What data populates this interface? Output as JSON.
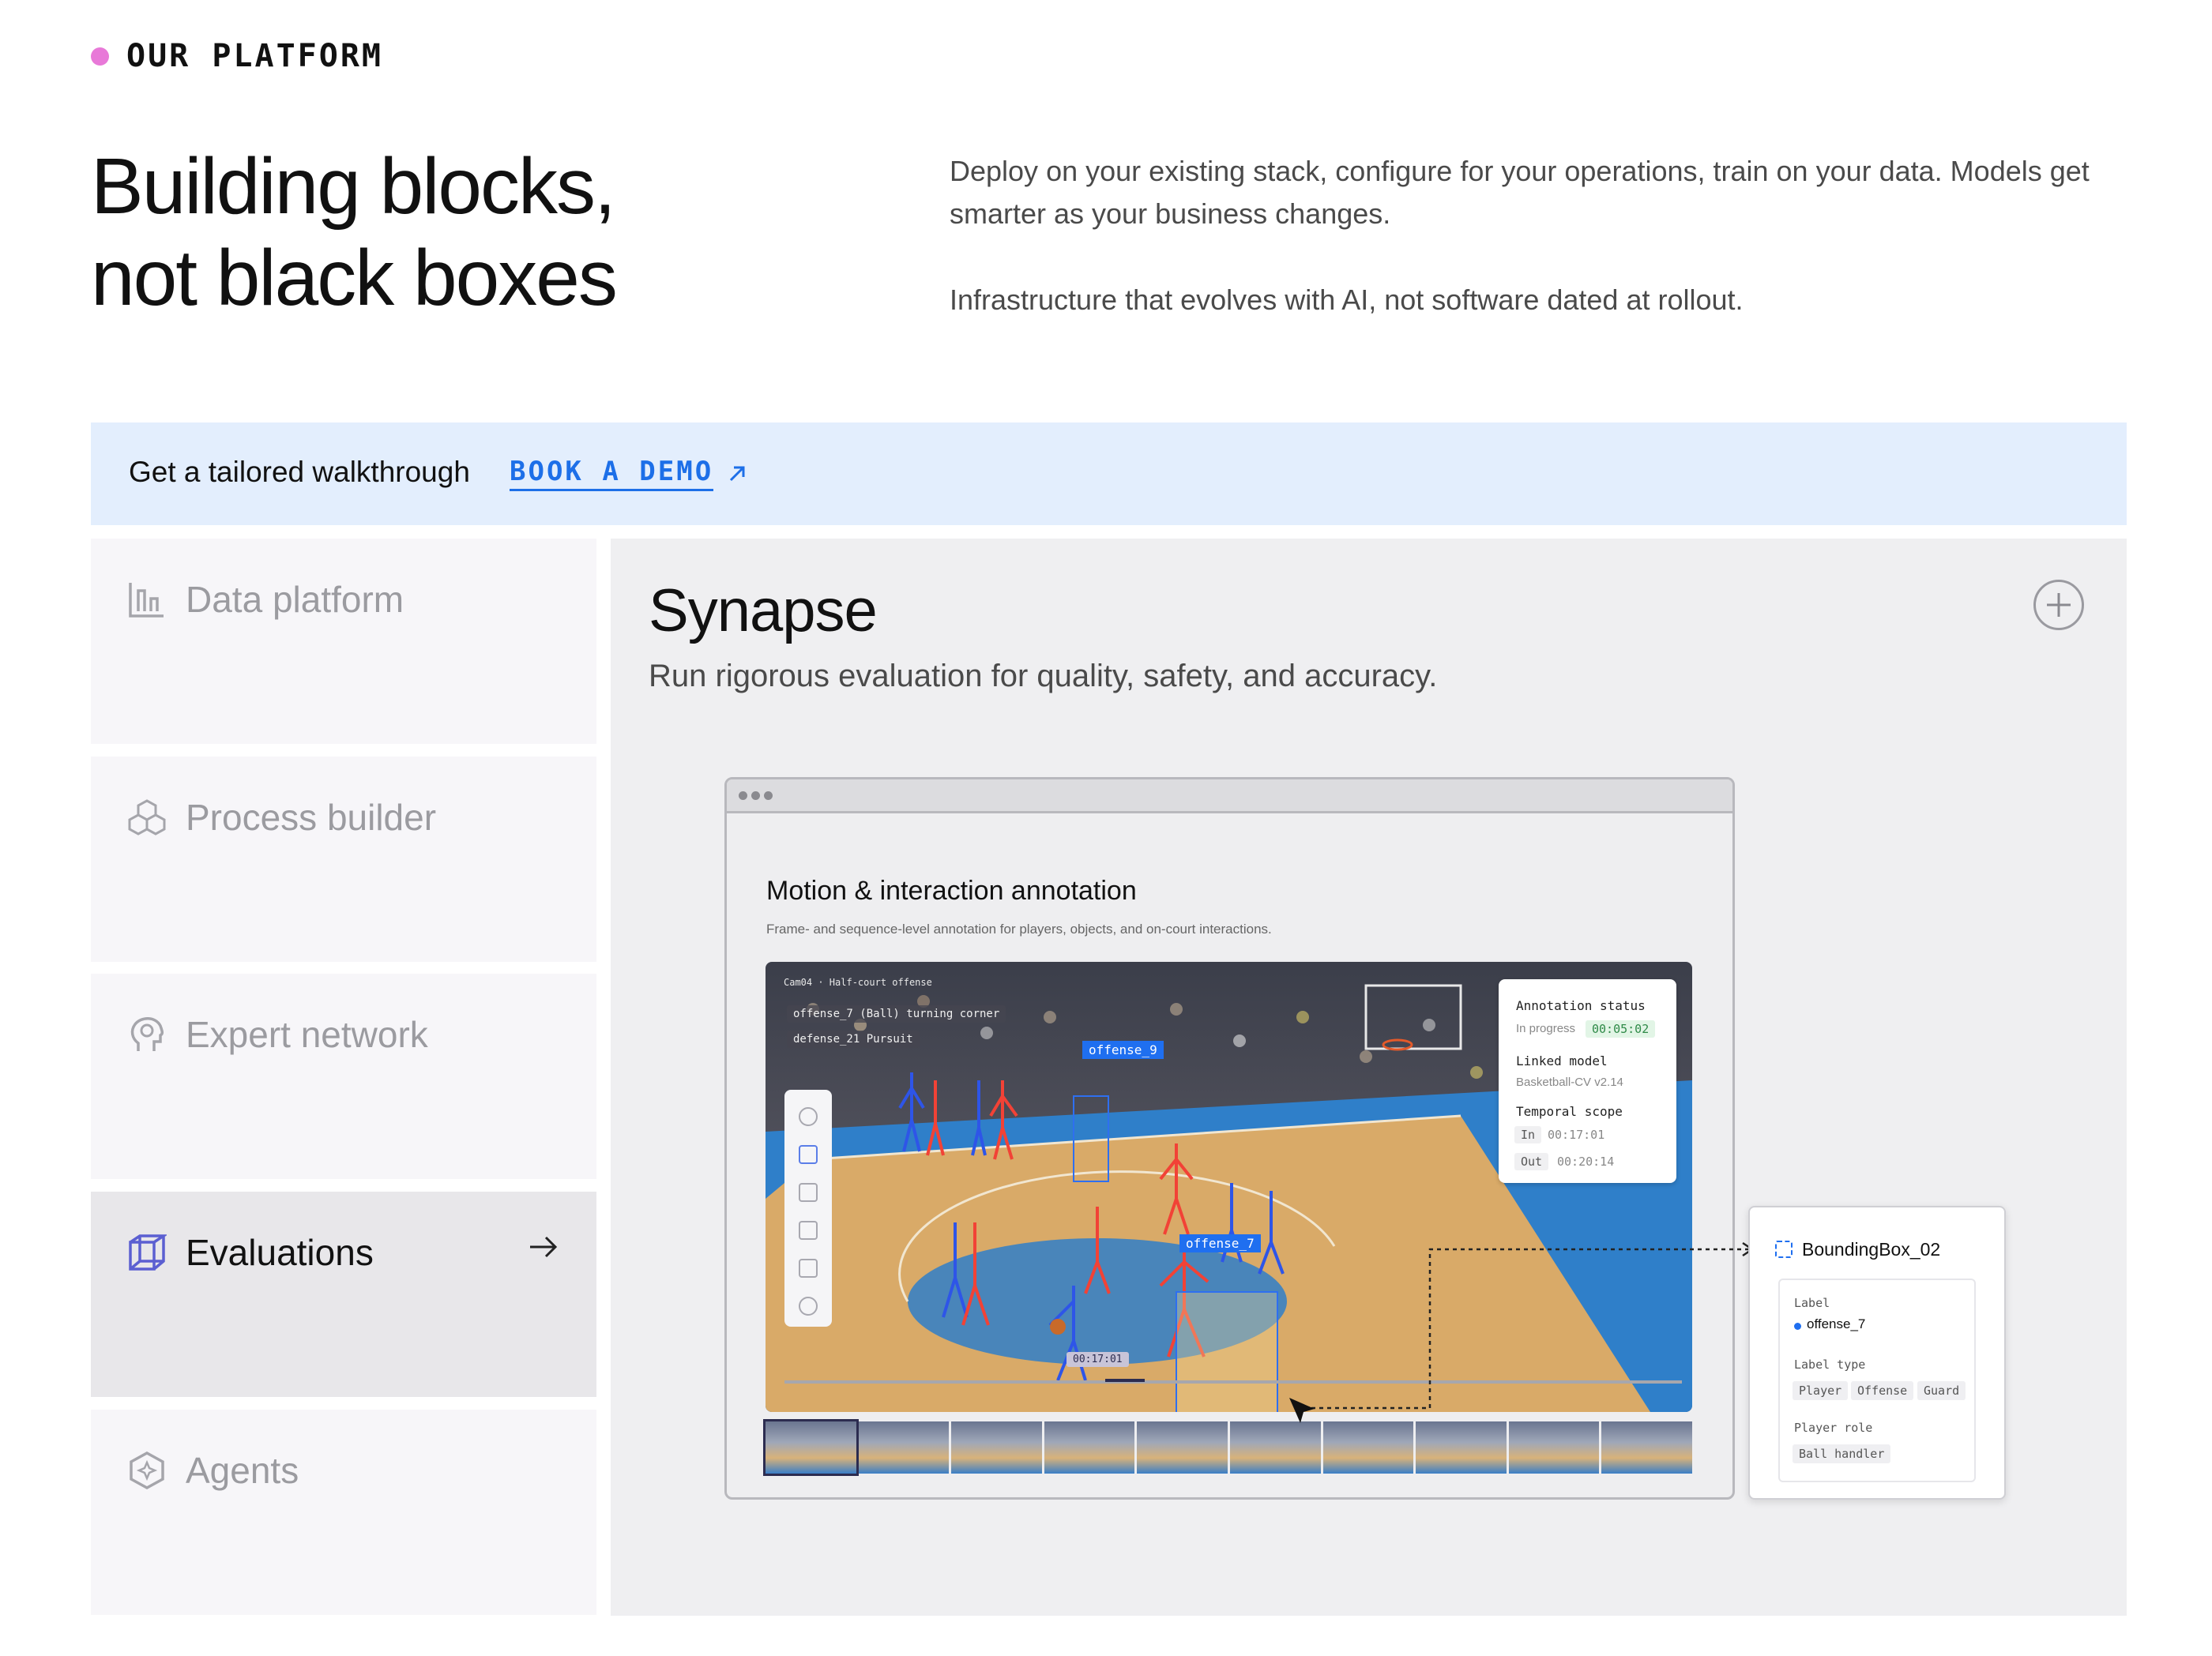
{
  "eyebrow": "OUR PLATFORM",
  "hero": {
    "title_line1": "Building blocks,",
    "title_line2": "not black boxes",
    "paragraph1": "Deploy on your existing stack, configure for your operations, train on your data. Models get smarter as your business changes.",
    "paragraph2": "Infrastructure that evolves with AI, not software dated at rollout."
  },
  "banner": {
    "label": "Get a tailored walkthrough",
    "cta": "BOOK A DEMO",
    "cta_icon": "arrow-up-right-icon",
    "background": "#e3eefd",
    "cta_color": "#1d6fe8"
  },
  "sidebar": {
    "items": [
      {
        "label": "Data platform",
        "icon": "chart-icon",
        "active": false
      },
      {
        "label": "Process builder",
        "icon": "blocks-icon",
        "active": false
      },
      {
        "label": "Expert network",
        "icon": "head-icon",
        "active": false
      },
      {
        "label": "Evaluations",
        "icon": "cube-icon",
        "active": true
      },
      {
        "label": "Agents",
        "icon": "hexagon-sparkle-icon",
        "active": false
      }
    ]
  },
  "panel": {
    "title": "Synapse",
    "subtitle": "Run rigorous evaluation for quality, safety, and accuracy.",
    "expand_icon": "plus-circle-icon"
  },
  "window": {
    "title": "Motion & interaction annotation",
    "subtitle": "Frame- and sequence-level annotation for players, objects, and on-court interactions.",
    "scene_tags": {
      "camera": "Cam04 · Half-court offense",
      "tag1": "offense_7 (Ball) turning corner",
      "tag2": "defense_21 Pursuit"
    },
    "bbox_labels": [
      "offense_9",
      "offense_7"
    ],
    "timecode": "00:17:01"
  },
  "status": {
    "annotation_status_label": "Annotation status",
    "annotation_status_value": "In progress",
    "annotation_time": "00:05:02",
    "linked_model_label": "Linked model",
    "linked_model_value": "Basketball-CV v2.14",
    "temporal_scope_label": "Temporal scope",
    "in_label": "In",
    "in_time": "00:17:01",
    "out_label": "Out",
    "out_time": "00:20:14"
  },
  "bbcard": {
    "title": "BoundingBox_02",
    "label_key": "Label",
    "label_value": "offense_7",
    "label_type_key": "Label type",
    "label_types": [
      "Player",
      "Offense",
      "Guard"
    ],
    "player_role_key": "Player role",
    "player_role_value": "Ball handler"
  }
}
